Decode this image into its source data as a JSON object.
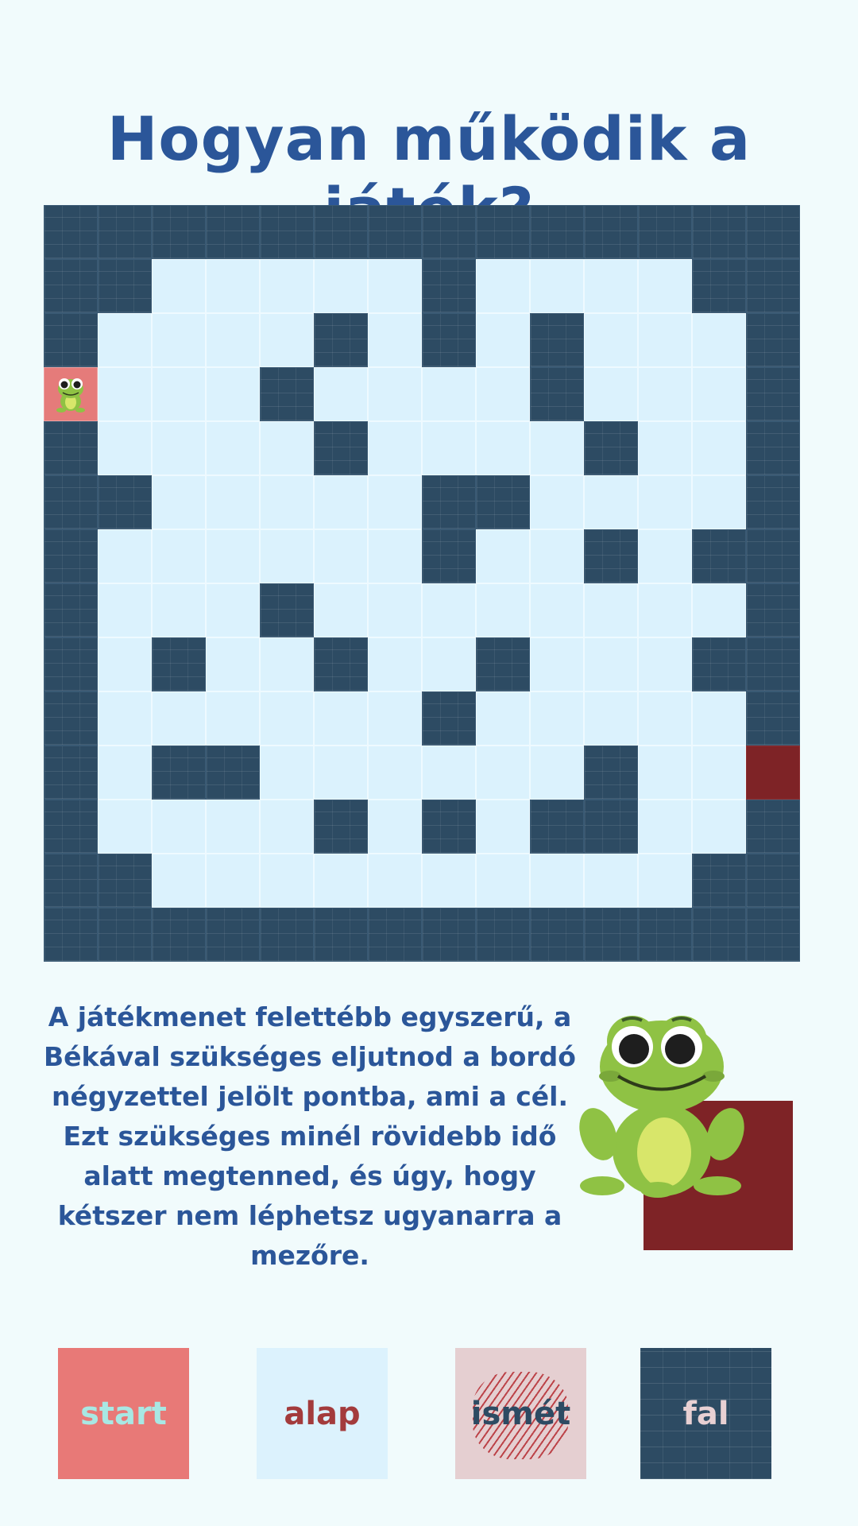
{
  "title": "Hogyan működik a játék?",
  "board": {
    "rows": [
      "WWWWWWWWWWWWWW",
      "WW.....W....WW",
      "W....W.W.W...W",
      "S...W....W...W",
      "W....W....W..W",
      "WW.....WW....W",
      "W......W..W.WW",
      "W...W........W",
      "W.W..W..W...WW",
      "W......W.....W",
      "W.WW......W..G",
      "W....W.W.WW..W",
      "WW..........WW",
      "WWWWWWWWWWWWWW"
    ]
  },
  "description": "A játékmenet felettébb egyszerű, a Békával szükséges eljutnod a bordó négyzettel jelölt pontba, ami a cél. Ezt szükséges minél rövidebb idő alatt megtenned, és úgy, hogy kétszer nem léphetsz ugyanarra a mezőre.",
  "legend": {
    "start": "start",
    "alap": "alap",
    "ismet": "ismét",
    "fal": "fal"
  },
  "colors": {
    "title": "#2b5699",
    "wall": "#2d4b63",
    "floor": "#dbf2fd",
    "start": "#e57b7a",
    "goal": "#7e2326",
    "revisited": "#e5cfd1"
  },
  "icons": {
    "player": "frog-icon",
    "illustration": "frog-illustration"
  }
}
